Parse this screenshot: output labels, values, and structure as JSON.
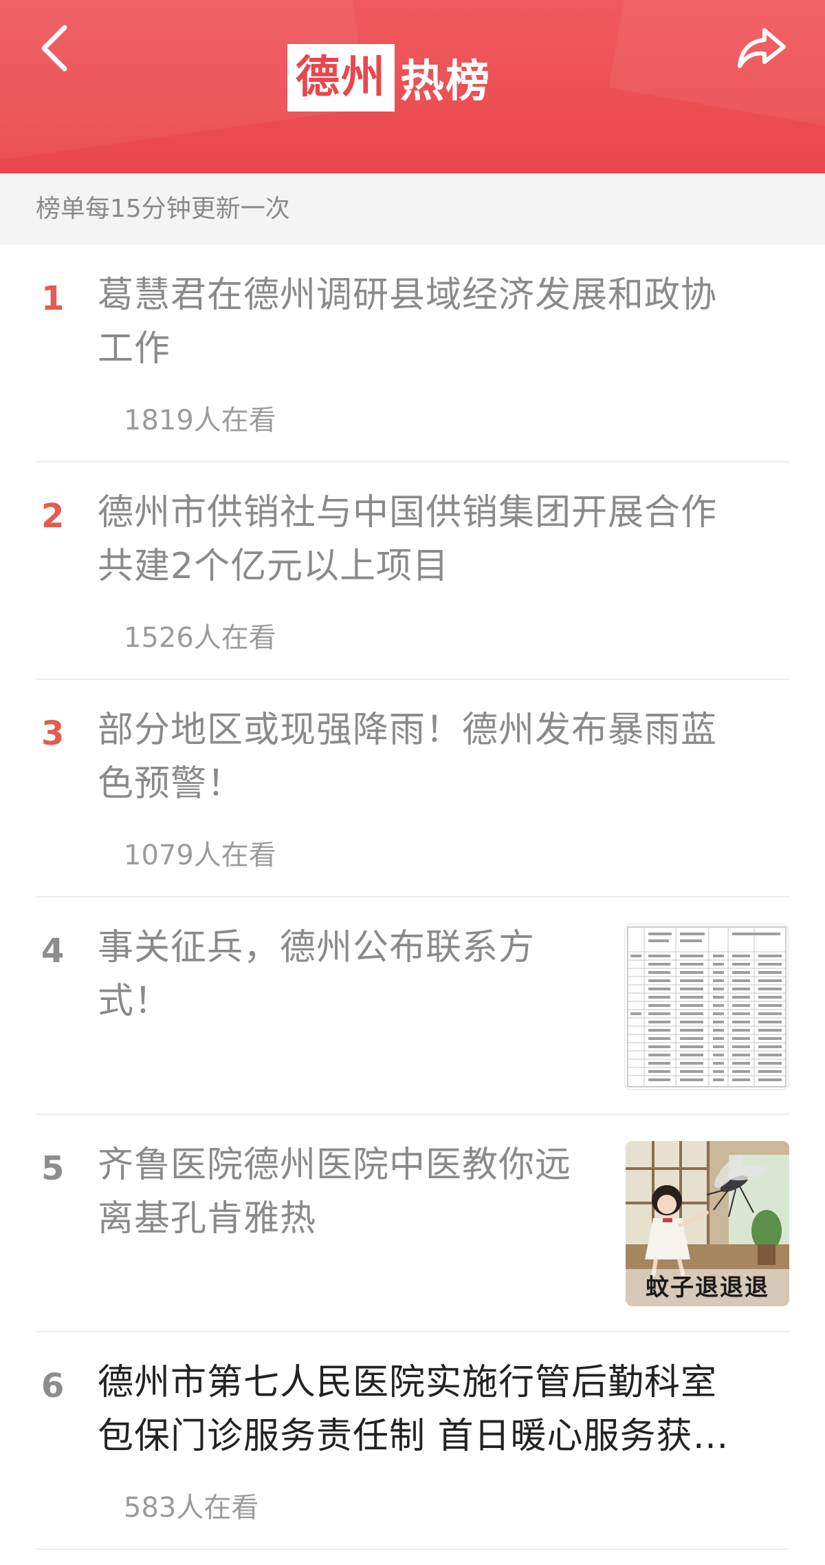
{
  "header": {
    "title_boxed": "德州",
    "title_rest": "热榜",
    "back_icon": "chevron-left-icon",
    "share_icon": "share-icon",
    "color": "#e8474c"
  },
  "notice": "榜单每15分钟更新一次",
  "items": [
    {
      "rank": "1",
      "title_lines": [
        "葛慧君在德州调研县域经济发展和政协",
        "工作"
      ],
      "viewers": "1819人在看",
      "thumbnail": null
    },
    {
      "rank": "2",
      "title_lines": [
        "德州市供销社与中国供销集团开展合作",
        "共建2个亿元以上项目"
      ],
      "viewers": "1526人在看",
      "thumbnail": null
    },
    {
      "rank": "3",
      "title_lines": [
        "部分地区或现强降雨！德州发布暴雨蓝",
        "色预警！"
      ],
      "viewers": "1079人在看",
      "thumbnail": null
    },
    {
      "rank": "4",
      "title_lines": [
        "事关征兵，德州公布联系方",
        "式！"
      ],
      "viewers": "",
      "thumbnail": "contact-table-image"
    },
    {
      "rank": "5",
      "title_lines": [
        "齐鲁医院德州医院中医教你远",
        "离基孔肯雅热"
      ],
      "viewers": "",
      "thumbnail": "mosquito-illustration",
      "thumbnail_caption": "蚊子退退退"
    },
    {
      "rank": "6",
      "title_lines": [
        "德州市第七人民医院实施行管后勤科室",
        "包保门诊服务责任制 首日暖心服务获…"
      ],
      "viewers": "583人在看",
      "thumbnail": null
    }
  ]
}
